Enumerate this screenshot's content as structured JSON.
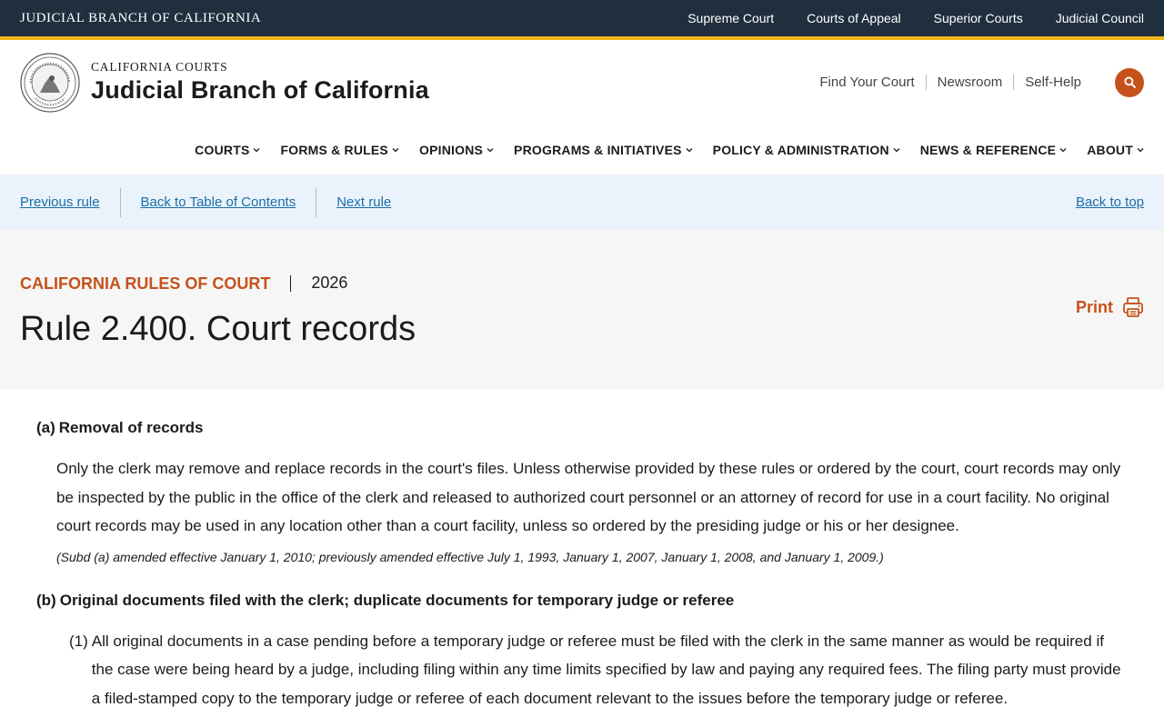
{
  "topbar": {
    "brand": "JUDICIAL BRANCH OF CALIFORNIA",
    "links": [
      "Supreme Court",
      "Courts of Appeal",
      "Superior Courts",
      "Judicial Council"
    ]
  },
  "header": {
    "subtitle": "CALIFORNIA COURTS",
    "title": "Judicial Branch of California",
    "util_links": [
      "Find Your Court",
      "Newsroom",
      "Self-Help"
    ],
    "search_icon": "search-icon"
  },
  "mainnav": {
    "items": [
      "COURTS",
      "FORMS & RULES",
      "OPINIONS",
      "PROGRAMS & INITIATIVES",
      "POLICY & ADMINISTRATION",
      "NEWS & REFERENCE",
      "ABOUT"
    ]
  },
  "rulebar": {
    "previous": "Previous rule",
    "toc": "Back to Table of Contents",
    "next": "Next rule",
    "back_to_top": "Back to top"
  },
  "titleblock": {
    "category": "CALIFORNIA RULES OF COURT",
    "year": "2026",
    "title": "Rule 2.400. Court records",
    "print": "Print"
  },
  "content": {
    "a_marker": "(a)",
    "a_heading": "Removal of records",
    "a_text": "Only the clerk may remove and replace records in the court's files. Unless otherwise provided by these rules or ordered by the court, court records may only be inspected by the public in the office of the clerk and released to authorized court personnel or an attorney of record for use in a court facility. No original court records may be used in any location other than a court facility, unless so ordered by the presiding judge or his or her designee.",
    "a_note": "(Subd (a) amended effective January 1, 2010; previously amended effective July 1, 1993, January 1, 2007, January 1, 2008, and January 1, 2009.)",
    "b_marker": "(b)",
    "b_heading": "Original documents filed with the clerk; duplicate documents for temporary judge or referee",
    "b1_num": "(1)",
    "b1_text": "All original documents in a case pending before a temporary judge or referee must be filed with the clerk in the same manner as would be required if the case were being heard by a judge, including filing within any time limits specified by law and paying any required fees. The filing party must provide a filed-stamped copy to the temporary judge or referee of each document relevant to the issues before the temporary judge or referee."
  },
  "colors": {
    "topbar": "#1f2f3e",
    "accent_gold": "#f2b51c",
    "accent_orange": "#c5521b",
    "link_blue": "#1b6ea8",
    "rulebar_bg": "#eaf3fb"
  }
}
